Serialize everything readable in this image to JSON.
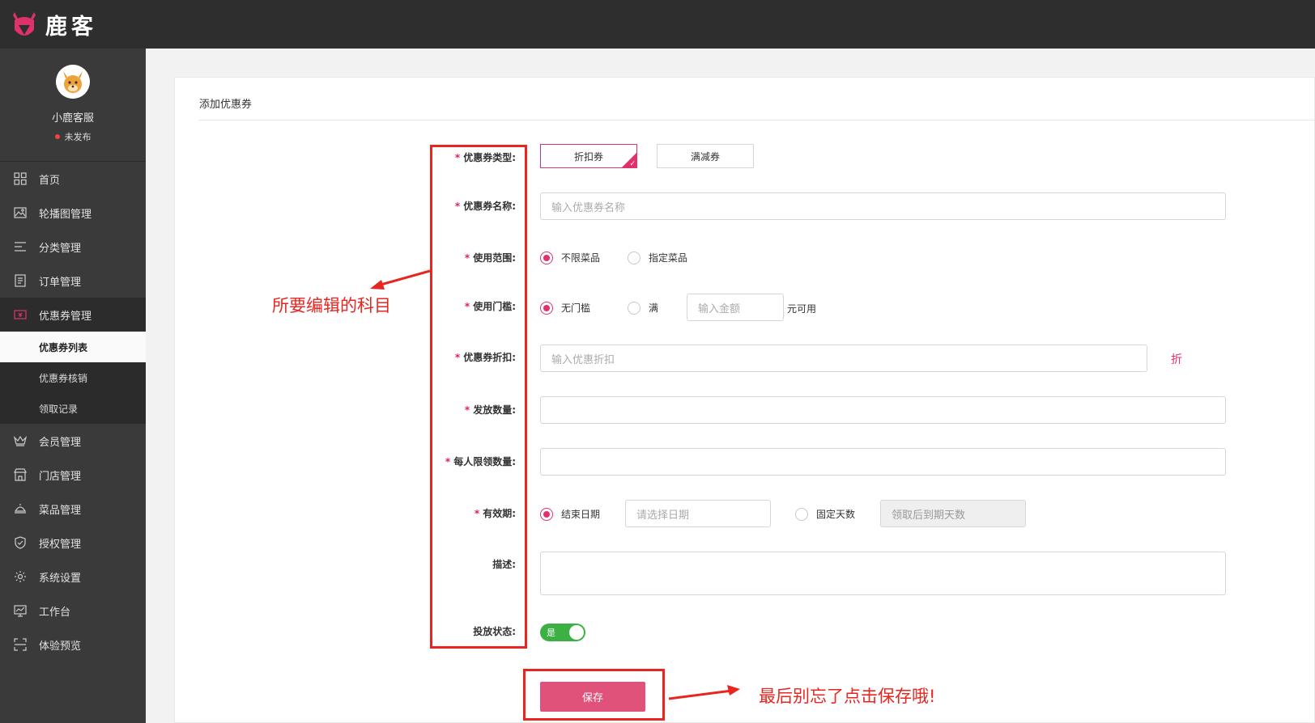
{
  "brand": {
    "name": "鹿客"
  },
  "sidebar": {
    "profile_name": "小鹿客服",
    "profile_status": "未发布",
    "items": [
      {
        "label": "首页",
        "icon": "grid-icon"
      },
      {
        "label": "轮播图管理",
        "icon": "image-icon"
      },
      {
        "label": "分类管理",
        "icon": "list-icon"
      },
      {
        "label": "订单管理",
        "icon": "document-icon"
      },
      {
        "label": "优惠券管理",
        "icon": "coupon-icon"
      }
    ],
    "sub_items": [
      {
        "label": "优惠券列表"
      },
      {
        "label": "优惠券核销"
      },
      {
        "label": "领取记录"
      }
    ],
    "items_after": [
      {
        "label": "会员管理",
        "icon": "crown-icon"
      },
      {
        "label": "门店管理",
        "icon": "store-icon"
      },
      {
        "label": "菜品管理",
        "icon": "dish-icon"
      },
      {
        "label": "授权管理",
        "icon": "shield-icon"
      },
      {
        "label": "系统设置",
        "icon": "gear-icon"
      },
      {
        "label": "工作台",
        "icon": "monitor-icon"
      },
      {
        "label": "体验预览",
        "icon": "scan-icon"
      }
    ]
  },
  "main": {
    "title": "添加优惠券",
    "form": {
      "type_label": "优惠券类型:",
      "type_options": [
        "折扣券",
        "满减券"
      ],
      "name_label": "优惠券名称:",
      "name_placeholder": "输入优惠券名称",
      "scope_label": "使用范围:",
      "scope_options": [
        "不限菜品",
        "指定菜品"
      ],
      "threshold_label": "使用门槛:",
      "threshold_options": [
        "无门槛",
        "满"
      ],
      "threshold_amount_placeholder": "输入金额",
      "threshold_suffix": "元可用",
      "discount_label": "优惠券折扣:",
      "discount_placeholder": "输入优惠折扣",
      "discount_unit": "折",
      "quantity_label": "发放数量:",
      "per_person_label": "每人限领数量:",
      "validity_label": "有效期:",
      "validity_options": [
        "结束日期",
        "固定天数"
      ],
      "end_date_placeholder": "请选择日期",
      "days_placeholder": "领取后到期天数",
      "desc_label": "描述:",
      "status_label": "投放状态:",
      "status_toggle": "是",
      "save_label": "保存"
    }
  },
  "annotations": {
    "left_note": "所要编辑的科目",
    "bottom_note": "最后别忘了点击保存哦!"
  },
  "colors": {
    "accent": "#e0326a",
    "annotation": "#e8261f",
    "toggle_on": "#3cb043",
    "sidebar": "#3a3a3a",
    "topbar": "#2e2e2e"
  }
}
